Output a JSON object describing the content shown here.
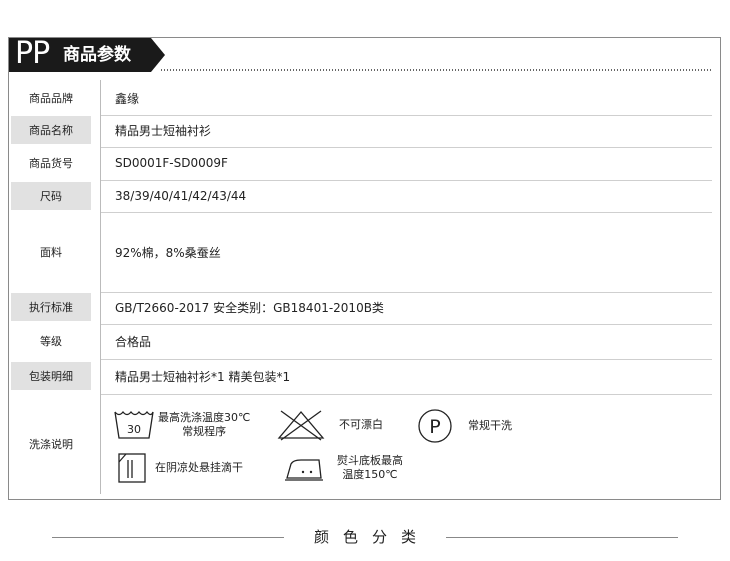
{
  "header": {
    "brand_letters": "PP",
    "title": "商品参数"
  },
  "rows": [
    {
      "label": "商品品牌",
      "value": "鑫缘"
    },
    {
      "label": "商品名称",
      "value": "精品男士短袖衬衫"
    },
    {
      "label": "商品货号",
      "value": "SD0001F-SD0009F"
    },
    {
      "label": "尺码",
      "value": "38/39/40/41/42/43/44"
    },
    {
      "label": "面料",
      "value": "92%棉，8%桑蚕丝"
    },
    {
      "label": "执行标准",
      "value": "GB/T2660-2017   安全类别：GB18401-2010B类"
    },
    {
      "label": "等级",
      "value": "合格品"
    },
    {
      "label": "包装明细",
      "value": "精品男士短袖衬衫*1   精美包装*1"
    },
    {
      "label": "洗涤说明",
      "value": ""
    }
  ],
  "care": {
    "wash": {
      "icon": "wash-tub-icon",
      "temp": "30",
      "line1": "最高洗涤温度30℃",
      "line2": "常规程序"
    },
    "no_bleach": {
      "icon": "no-bleach-icon",
      "text": "不可漂白"
    },
    "dry_clean": {
      "icon": "dry-clean-p-icon",
      "letter": "P",
      "text": "常规干洗"
    },
    "hang_dry": {
      "icon": "drip-dry-shade-icon",
      "text": "在阴凉处悬挂滴干"
    },
    "iron": {
      "icon": "iron-icon",
      "line1": "熨斗底板最高",
      "line2": "温度150℃"
    }
  },
  "footer": {
    "title": "颜色分类"
  }
}
